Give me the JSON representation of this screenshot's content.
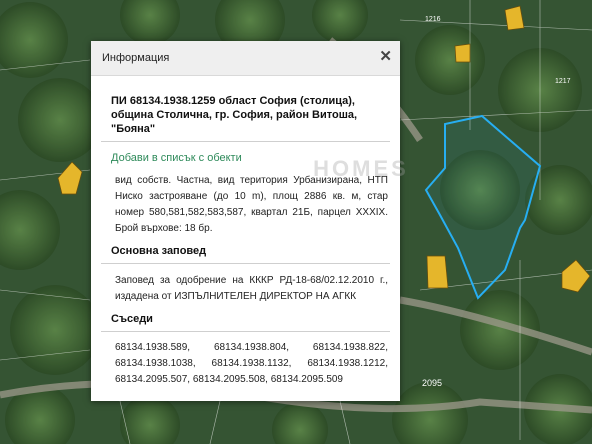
{
  "map": {
    "parcel_labels": [
      "1216",
      "1217",
      "2095"
    ],
    "accent_color": "#27aef2",
    "building_color": "#e5b62b"
  },
  "popup": {
    "title": "Информация",
    "close_glyph": "✕",
    "heading": "ПИ 68134.1938.1259 област София (столица), община Столична, гр. София, район Витоша, \"Бояна\"",
    "add_link": "Добави в списък с обекти",
    "details": "вид собств. Частна, вид територия Урбанизирана, НТП Ниско застрояване (до 10 m), площ 2886 кв. м, стар номер 580,581,582,583,587, квартал 21Б, парцел XXXIX. Брой върхове: 18 бр.",
    "order_title": "Основна заповед",
    "order_text": "Заповед за одобрение на КККР РД-18-68/02.12.2010 г., издадена от ИЗПЪЛНИТЕЛЕН ДИРЕКТОР НА АГКК",
    "neighbors_title": "Съседи",
    "neighbors_text": "68134.1938.589, 68134.1938.804, 68134.1938.822, 68134.1938.1038, 68134.1938.1132, 68134.1938.1212, 68134.2095.507, 68134.2095.508, 68134.2095.509",
    "watermark": "HOMES"
  }
}
